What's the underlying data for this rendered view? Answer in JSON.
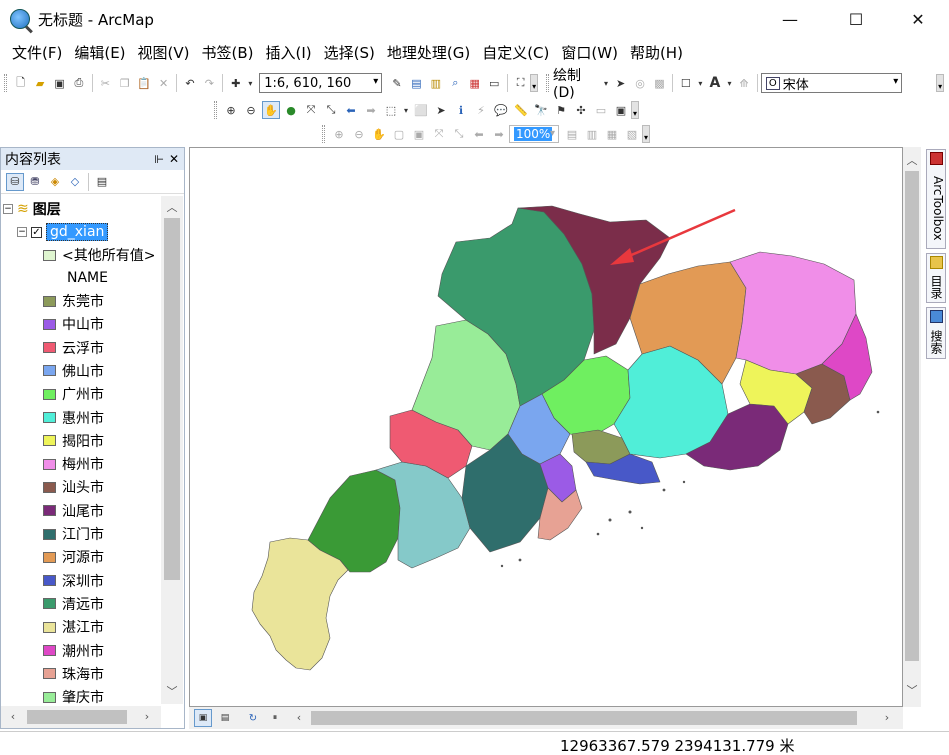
{
  "window": {
    "title": "无标题 - ArcMap",
    "minimize": "—",
    "maximize": "☐",
    "close": "✕"
  },
  "menu": [
    "文件(F)",
    "编辑(E)",
    "视图(V)",
    "书签(B)",
    "插入(I)",
    "选择(S)",
    "地理处理(G)",
    "自定义(C)",
    "窗口(W)",
    "帮助(H)"
  ],
  "toolbar": {
    "scale_value": "1:6, 610, 160",
    "draw_label": "绘制(D)",
    "text_tool": "A",
    "font_value": "宋体",
    "zoom_value": "100%"
  },
  "toc": {
    "title": "内容列表",
    "pin": "ᵖ",
    "close": "✕",
    "root_label": "图层",
    "layer_name": "gd_xian",
    "other_values": "<其他所有值>",
    "field_name": "NAME",
    "classes": [
      {
        "name": "东莞市",
        "color": "#8c9a5a"
      },
      {
        "name": "中山市",
        "color": "#9b5be6"
      },
      {
        "name": "云浮市",
        "color": "#ef5a72"
      },
      {
        "name": "佛山市",
        "color": "#7aa6ef"
      },
      {
        "name": "广州市",
        "color": "#6fef60"
      },
      {
        "name": "惠州市",
        "color": "#50eed8"
      },
      {
        "name": "揭阳市",
        "color": "#eef45a"
      },
      {
        "name": "梅州市",
        "color": "#f08ee8"
      },
      {
        "name": "汕头市",
        "color": "#8a5a4e"
      },
      {
        "name": "汕尾市",
        "color": "#7a2a78"
      },
      {
        "name": "江门市",
        "color": "#2f6e6c"
      },
      {
        "name": "河源市",
        "color": "#e29a55"
      },
      {
        "name": "深圳市",
        "color": "#4858c8"
      },
      {
        "name": "清远市",
        "color": "#3a9a6c"
      },
      {
        "name": "湛江市",
        "color": "#eae49a"
      },
      {
        "name": "潮州市",
        "color": "#de48c6"
      },
      {
        "name": "珠海市",
        "color": "#e7a294"
      },
      {
        "name": "肇庆市",
        "color": "#98ec98"
      }
    ],
    "other_color": "#dff5d0"
  },
  "dock": {
    "toolbox": "ArcToolbox",
    "catalog": "目录",
    "search": "搜索"
  },
  "map_colors": {
    "shaoguan": "#7b2d4a",
    "arrow": "#e8383d"
  },
  "status": {
    "coordinates": "12963367.579  2394131.779 米"
  }
}
